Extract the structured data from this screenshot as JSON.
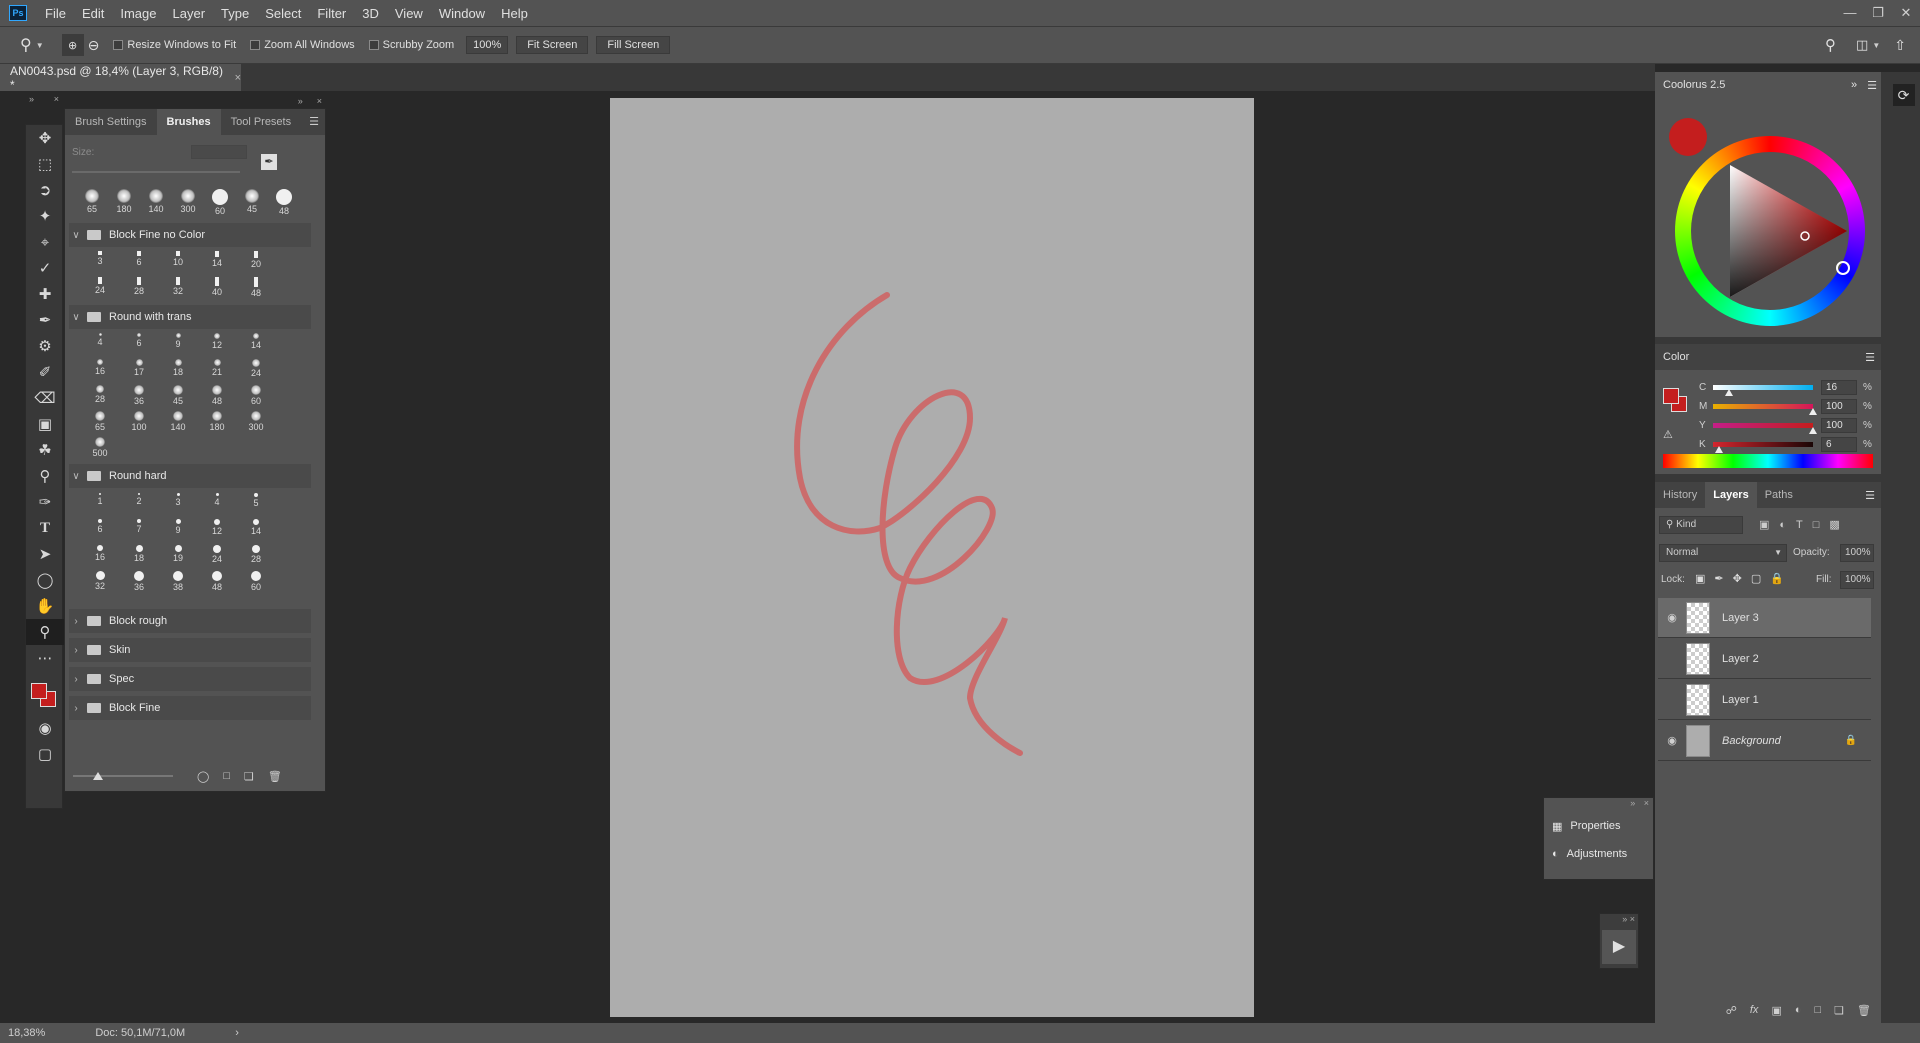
{
  "app": {
    "logo": "Ps"
  },
  "menu": [
    "File",
    "Edit",
    "Image",
    "Layer",
    "Type",
    "Select",
    "Filter",
    "3D",
    "View",
    "Window",
    "Help"
  ],
  "window_buttons": [
    "minimize-icon",
    "restore-icon",
    "close-icon"
  ],
  "options": {
    "resize_windows": "Resize Windows to Fit",
    "zoom_all": "Zoom All Windows",
    "scrubby_zoom": "Scrubby Zoom",
    "zoom_value": "100%",
    "fit_screen": "Fit Screen",
    "fill_screen": "Fill Screen"
  },
  "document_tab": {
    "title": "AN0043.psd @ 18,4% (Layer 3, RGB/8) *",
    "close": "×"
  },
  "tools": [
    "move-icon",
    "marquee-icon",
    "lasso-icon",
    "magic-wand-icon",
    "crop-icon",
    "eyedropper-icon",
    "healing-icon",
    "brush-icon",
    "stamp-icon",
    "history-brush-icon",
    "eraser-icon",
    "gradient-icon",
    "smudge-icon",
    "dodge-icon",
    "pen-icon",
    "type-icon",
    "path-select-icon",
    "ellipse-icon",
    "hand-icon",
    "zoom-icon",
    "more-icon"
  ],
  "colors": {
    "foreground": "#c41e1e",
    "background": "#c41e1e",
    "canvas": "#adadad",
    "stroke": "#d06060"
  },
  "brushes_panel": {
    "tabs": [
      "Brush Settings",
      "Brushes",
      "Tool Presets"
    ],
    "size_label": "Size:",
    "presets": [
      "65",
      "180",
      "140",
      "300",
      "60",
      "45",
      "48"
    ],
    "groups": [
      {
        "name": "Block Fine no Color",
        "brushes": [
          "3",
          "6",
          "10",
          "14",
          "20",
          "24",
          "28",
          "32",
          "40",
          "48"
        ]
      },
      {
        "name": "Round with trans",
        "brushes": [
          "4",
          "6",
          "9",
          "12",
          "14",
          "16",
          "17",
          "18",
          "21",
          "24",
          "28",
          "36",
          "45",
          "48",
          "60",
          "65",
          "100",
          "140",
          "180",
          "300",
          "500"
        ]
      },
      {
        "name": "Round hard",
        "brushes": [
          "1",
          "2",
          "3",
          "4",
          "5",
          "6",
          "7",
          "9",
          "12",
          "14",
          "16",
          "18",
          "19",
          "24",
          "28",
          "32",
          "36",
          "38",
          "48",
          "60"
        ]
      },
      {
        "name": "Block rough"
      },
      {
        "name": "Skin"
      },
      {
        "name": "Spec"
      },
      {
        "name": "Block Fine"
      }
    ]
  },
  "coolorus": {
    "title": "Coolorus 2.5"
  },
  "color_panel": {
    "title": "Color",
    "channels": [
      {
        "label": "C",
        "value": "16",
        "unit": "%",
        "pct": 16
      },
      {
        "label": "M",
        "value": "100",
        "unit": "%",
        "pct": 100
      },
      {
        "label": "Y",
        "value": "100",
        "unit": "%",
        "pct": 100
      },
      {
        "label": "K",
        "value": "6",
        "unit": "%",
        "pct": 6
      }
    ]
  },
  "layers_panel": {
    "tabs": [
      "History",
      "Layers",
      "Paths"
    ],
    "kind": "Kind",
    "blend_mode": "Normal",
    "opacity_label": "Opacity:",
    "opacity_value": "100%",
    "lock_label": "Lock:",
    "fill_label": "Fill:",
    "fill_value": "100%",
    "layers": [
      {
        "name": "Layer 3",
        "visible": true,
        "selected": true
      },
      {
        "name": "Layer 2",
        "visible": false
      },
      {
        "name": "Layer 1",
        "visible": false
      },
      {
        "name": "Background",
        "visible": true,
        "locked": true
      }
    ]
  },
  "properties_panel": {
    "properties": "Properties",
    "adjustments": "Adjustments"
  },
  "status": {
    "zoom": "18,38%",
    "doc": "Doc: 50,1M/71,0M"
  }
}
